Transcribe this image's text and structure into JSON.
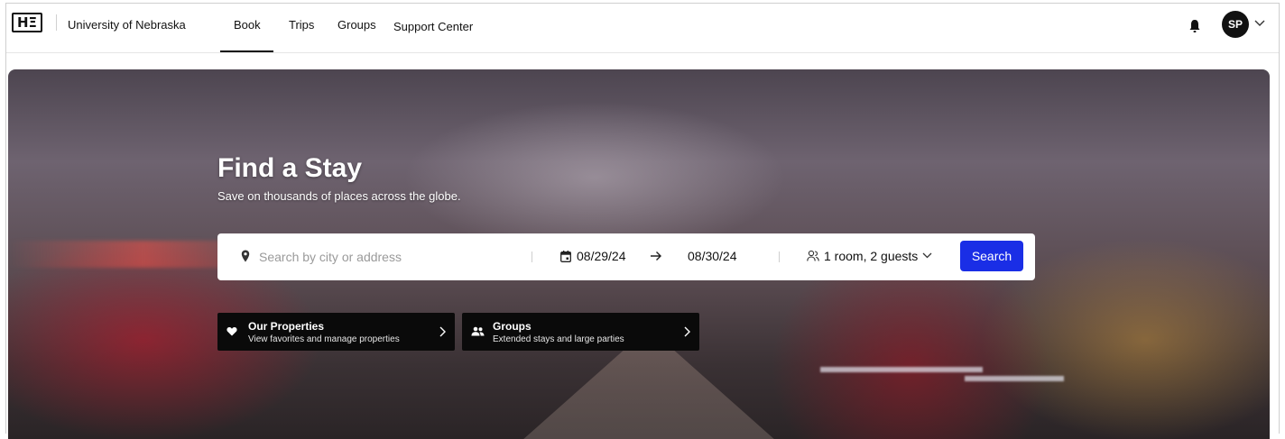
{
  "header": {
    "logo_text": "HΞ",
    "org_name": "University of Nebraska",
    "nav": [
      {
        "label": "Book"
      },
      {
        "label": "Trips"
      },
      {
        "label": "Groups"
      },
      {
        "label": "Support Center"
      }
    ],
    "active_nav": "Book",
    "avatar_initials": "SP",
    "icons": {
      "notifications": "bell-icon",
      "account_menu": "chevron-down-icon"
    }
  },
  "hero": {
    "title": "Find a Stay",
    "subtitle": "Save on thousands of places across the globe.",
    "search": {
      "location_placeholder": "Search by city or address",
      "location_value": "",
      "check_in": "08/29/24",
      "check_out": "08/30/24",
      "guests": "1 room, 2 guests",
      "button_label": "Search"
    },
    "cards": [
      {
        "title": "Our Properties",
        "subtitle": "View favorites and manage properties",
        "icon": "heart-icon"
      },
      {
        "title": "Groups",
        "subtitle": "Extended stays and large parties",
        "icon": "people-icon"
      }
    ]
  },
  "colors": {
    "primary_button": "#1a2ee6",
    "card_background": "#0a0a0a",
    "text": "#111111"
  }
}
